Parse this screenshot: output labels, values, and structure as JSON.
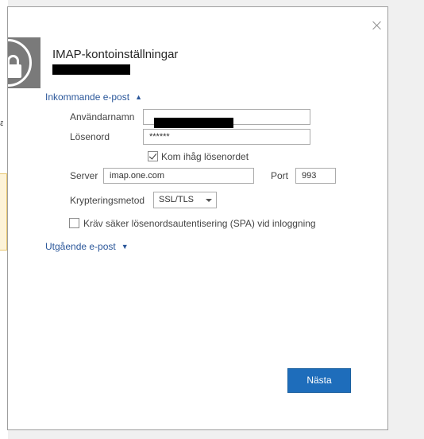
{
  "dialog": {
    "title": "IMAP-kontoinställningar",
    "incoming_section": "Inkommande e-post",
    "outgoing_section": "Utgående e-post",
    "username_label": "Användarnamn",
    "password_label": "Lösenord",
    "password_value": "******",
    "remember_password_label": "Kom ihåg lösenordet",
    "remember_password_checked": true,
    "server_label": "Server",
    "server_value": "imap.one.com",
    "port_label": "Port",
    "port_value": "993",
    "encryption_label": "Krypteringsmetod",
    "encryption_value": "SSL/TLS",
    "spa_label": "Kräv säker lösenordsautentisering (SPA) vid inloggning",
    "spa_checked": false,
    "next_button": "Nästa"
  },
  "icons": {
    "close": "close-icon",
    "lock": "lock-icon",
    "chevron_up": "chevron-up-icon",
    "chevron_down": "chevron-down-icon",
    "dropdown": "dropdown-arrow-icon"
  },
  "colors": {
    "accent": "#1e6dbb",
    "link": "#2b579a",
    "lock_tile": "#7a7a7a"
  }
}
